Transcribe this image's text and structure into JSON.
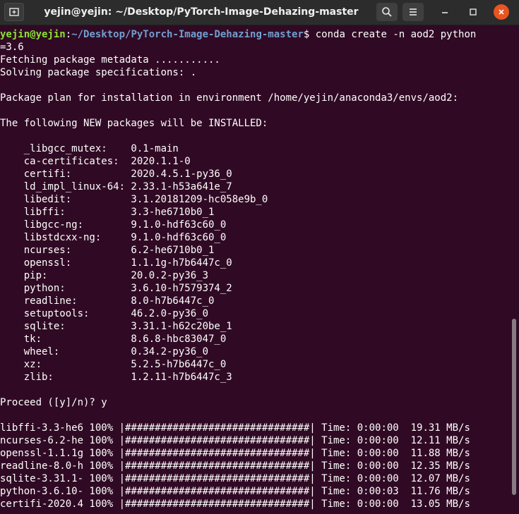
{
  "window": {
    "title": "yejin@yejin: ~/Desktop/PyTorch-Image-Dehazing-master",
    "icons": {
      "new_tab": "new-tab-icon",
      "search": "search-icon",
      "menu": "hamburger-menu-icon",
      "minimize": "minimize-icon",
      "maximize": "maximize-icon",
      "close": "close-icon"
    },
    "colors": {
      "terminal_bg": "#300a24",
      "titlebar_bg": "#2c2c2c",
      "prompt_user": "#8ae234",
      "prompt_path": "#729fcf",
      "text": "#ffffff",
      "close_button": "#e95420"
    }
  },
  "terminal": {
    "prompt": {
      "user_host": "yejin@yejin",
      "colon": ":",
      "path": "~/Desktop/PyTorch-Image-Dehazing-master",
      "symbol": "$ ",
      "command": "conda create -n aod2 python",
      "command_wrap": "=3.6"
    },
    "lines": [
      "Fetching package metadata ...........",
      "Solving package specifications: .",
      "",
      "Package plan for installation in environment /home/yejin/anaconda3/envs/aod2:",
      "",
      "The following NEW packages will be INSTALLED:",
      "",
      "    _libgcc_mutex:    0.1-main",
      "    ca-certificates:  2020.1.1-0",
      "    certifi:          2020.4.5.1-py36_0",
      "    ld_impl_linux-64: 2.33.1-h53a641e_7",
      "    libedit:          3.1.20181209-hc058e9b_0",
      "    libffi:           3.3-he6710b0_1",
      "    libgcc-ng:        9.1.0-hdf63c60_0",
      "    libstdcxx-ng:     9.1.0-hdf63c60_0",
      "    ncurses:          6.2-he6710b0_1",
      "    openssl:          1.1.1g-h7b6447c_0",
      "    pip:              20.0.2-py36_3",
      "    python:           3.6.10-h7579374_2",
      "    readline:         8.0-h7b6447c_0",
      "    setuptools:       46.2.0-py36_0",
      "    sqlite:           3.31.1-h62c20be_1",
      "    tk:               8.6.8-hbc83047_0",
      "    wheel:            0.34.2-py36_0",
      "    xz:               5.2.5-h7b6447c_0",
      "    zlib:             1.2.11-h7b6447c_3",
      "",
      "Proceed ([y]/n)? y",
      "",
      "libffi-3.3-he6 100% |###############################| Time: 0:00:00  19.31 MB/s",
      "ncurses-6.2-he 100% |###############################| Time: 0:00:00  12.11 MB/s",
      "openssl-1.1.1g 100% |###############################| Time: 0:00:00  11.88 MB/s",
      "readline-8.0-h 100% |###############################| Time: 0:00:00  12.35 MB/s",
      "sqlite-3.31.1- 100% |###############################| Time: 0:00:00  12.07 MB/s",
      "python-3.6.10- 100% |###############################| Time: 0:00:03  11.76 MB/s",
      "certifi-2020.4 100% |###############################| Time: 0:00:00  13.05 MB/s"
    ]
  }
}
